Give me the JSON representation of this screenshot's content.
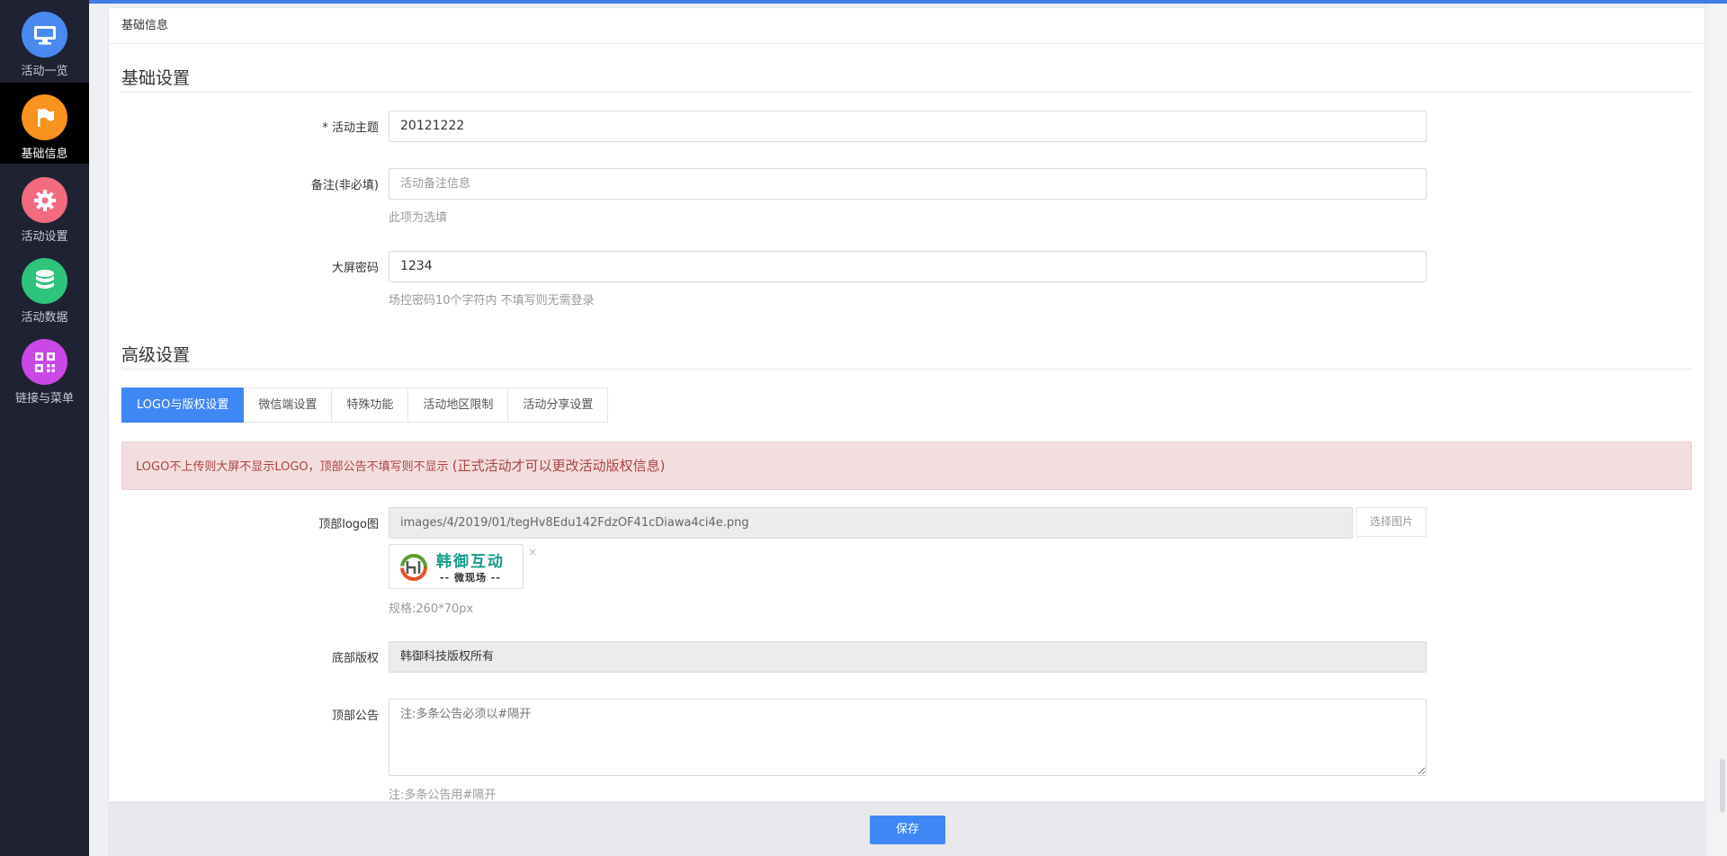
{
  "sidebar": {
    "items": [
      {
        "label": "活动一览",
        "icon": "monitor-icon",
        "color": "#4a8af0",
        "active": false
      },
      {
        "label": "基础信息",
        "icon": "flag-icon",
        "color": "#f7931e",
        "active": true
      },
      {
        "label": "活动设置",
        "icon": "gear-icon",
        "color": "#f36b7f",
        "active": false
      },
      {
        "label": "活动数据",
        "icon": "database-icon",
        "color": "#2ec47c",
        "active": false
      },
      {
        "label": "链接与菜单",
        "icon": "qrcode-icon",
        "color": "#c948e6",
        "active": false
      }
    ]
  },
  "panel": {
    "title": "基础信息"
  },
  "basic": {
    "section_title": "基础设置",
    "theme_label": "* 活动主题",
    "theme_value": "20121222",
    "remark_label": "备注(非必填)",
    "remark_placeholder": "活动备注信息",
    "remark_help": "此项为选填",
    "password_label": "大屏密码",
    "password_value": "1234",
    "password_help": "场控密码10个字符内 不填写则无需登录"
  },
  "advanced": {
    "section_title": "高级设置",
    "tabs": [
      "LOGO与版权设置",
      "微信端设置",
      "特殊功能",
      "活动地区限制",
      "活动分享设置"
    ],
    "alert_text": "LOGO不上传则大屏不显示LOGO，顶部公告不填写则不显示 ",
    "alert_emphasis": "(正式活动才可以更改活动版权信息)",
    "logo_label": "顶部logo图",
    "logo_path": "images/4/2019/01/tegHv8Edu142FdzOF41cDiawa4ci4e.png",
    "logo_button": "选择图片",
    "logo_remove": "×",
    "logo_brand": "韩御互动",
    "logo_sub": "-- 微现场 --",
    "logo_spec": "规格:260*70px",
    "copyright_label": "底部版权",
    "copyright_value": "韩御科技版权所有",
    "notice_label": "顶部公告",
    "notice_placeholder": "注:多条公告必须以#隔开",
    "notice_help": "注:多条公告用#隔开"
  },
  "footer": {
    "save_label": "保存"
  },
  "colors": {
    "accent": "#3f87f5",
    "sidebar_bg": "#1f2233",
    "alert_bg": "#f2dede",
    "alert_text": "#a94442"
  }
}
